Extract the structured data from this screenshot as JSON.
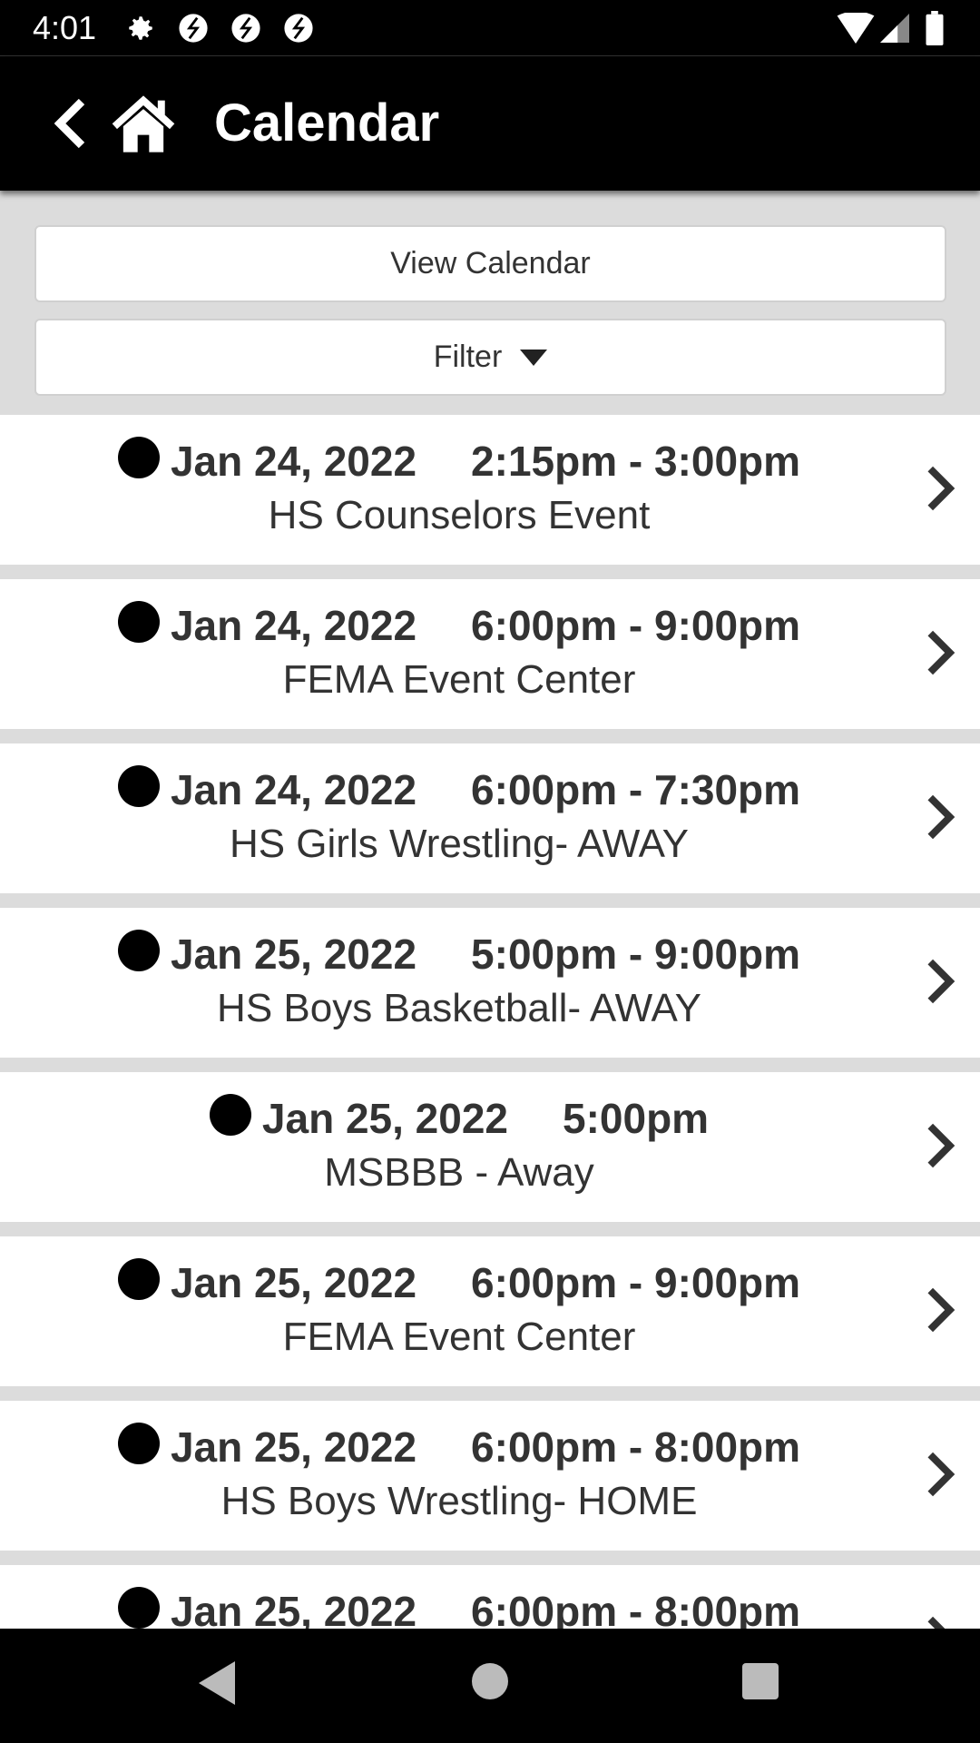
{
  "status_bar": {
    "time": "4:01",
    "icons": [
      "gear-icon",
      "sync-icon",
      "sync-icon",
      "sync-icon"
    ],
    "right_icons": [
      "wifi-icon",
      "signal-icon",
      "battery-icon"
    ]
  },
  "header": {
    "title": "Calendar"
  },
  "actions": {
    "view_calendar": "View Calendar",
    "filter": "Filter"
  },
  "events": [
    {
      "date": "Jan 24, 2022",
      "time": "2:15pm - 3:00pm",
      "name": "HS Counselors Event"
    },
    {
      "date": "Jan 24, 2022",
      "time": "6:00pm - 9:00pm",
      "name": "FEMA Event Center"
    },
    {
      "date": "Jan 24, 2022",
      "time": "6:00pm - 7:30pm",
      "name": "HS Girls Wrestling- AWAY"
    },
    {
      "date": "Jan 25, 2022",
      "time": "5:00pm - 9:00pm",
      "name": "HS Boys Basketball- AWAY"
    },
    {
      "date": "Jan 25, 2022",
      "time": "5:00pm",
      "name": "MSBBB - Away"
    },
    {
      "date": "Jan 25, 2022",
      "time": "6:00pm - 9:00pm",
      "name": "FEMA Event Center"
    },
    {
      "date": "Jan 25, 2022",
      "time": "6:00pm - 8:00pm",
      "name": "HS Boys Wrestling- HOME"
    },
    {
      "date": "Jan 25, 2022",
      "time": "6:00pm - 8:00pm",
      "name": ""
    }
  ]
}
